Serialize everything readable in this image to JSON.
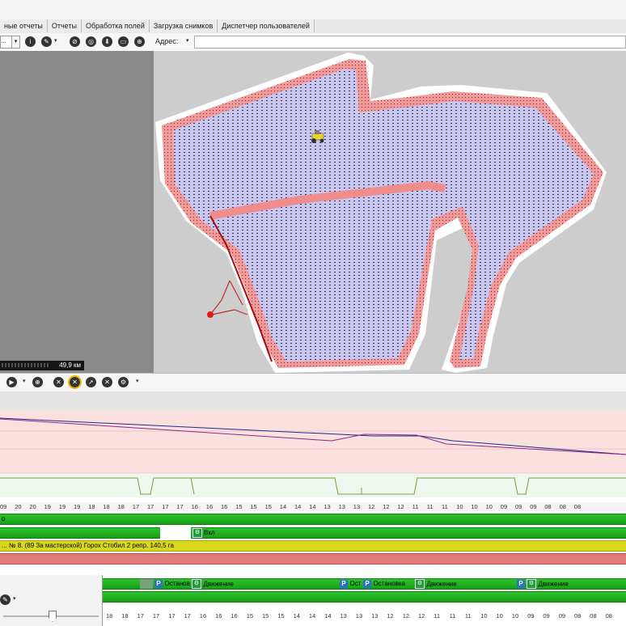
{
  "tabs": [
    "ные отчеты",
    "Отчеты",
    "Обработка полей",
    "Загрузка снимков",
    "Диспетчер пользователей"
  ],
  "toolbar": {
    "combo_value": "...",
    "address_label": "Адрес:",
    "address_value": ""
  },
  "map": {
    "scale_label": "49,9 км"
  },
  "timeline": {
    "ticks_top": [
      "09",
      "20",
      "20",
      "19",
      "19",
      "19",
      "18",
      "18",
      "18",
      "17",
      "17",
      "17",
      "17",
      "16",
      "16",
      "16",
      "15",
      "15",
      "15",
      "14",
      "14",
      "14",
      "13",
      "13",
      "13",
      "12",
      "12",
      "12",
      "11",
      "11",
      "11",
      "10",
      "10",
      "10",
      "09",
      "09",
      "09",
      "08",
      "08",
      "08"
    ],
    "ticks_bottom": [
      "18",
      "18",
      "17",
      "17",
      "17",
      "17",
      "16",
      "16",
      "16",
      "15",
      "15",
      "15",
      "14",
      "14",
      "14",
      "13",
      "13",
      "13",
      "12",
      "12",
      "12",
      "11",
      "11",
      "11",
      "10",
      "10",
      "10",
      "09",
      "09",
      "09",
      "08",
      "08",
      "08"
    ],
    "lane1_label": "о",
    "lane2_label": "Вкл",
    "lane3_label": "... № 8. (89 За мастерской) Горох Стобил 2 репр. 140,5 га",
    "events": [
      {
        "badge": "P",
        "label": "Останов"
      },
      {
        "badge": "G",
        "label": "Движение"
      },
      {
        "badge": "P",
        "label": "Ост"
      },
      {
        "badge": "P",
        "label": "Остановка"
      },
      {
        "badge": "G",
        "label": "Движение"
      },
      {
        "badge": "P",
        "label": ""
      },
      {
        "badge": "G",
        "label": "Движение"
      }
    ]
  },
  "colors": {
    "field_fill": "#c9c6ef",
    "field_border": "#f08c8c",
    "chart_bg": "#fbe0e0",
    "green": "#21b021",
    "yellow": "#d8d81a",
    "salmon": "#e07a7a"
  }
}
